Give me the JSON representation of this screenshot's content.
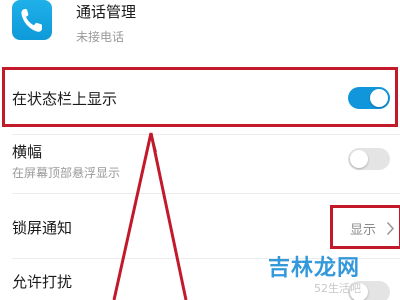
{
  "header": {
    "app_icon": "phone-icon",
    "app_name": "通话管理",
    "subtitle": "未接电话"
  },
  "settings": [
    {
      "title": "在状态栏上显示",
      "toggle_on": true
    },
    {
      "title": "横幅",
      "subtitle": "在屏幕顶部悬浮显示",
      "toggle_on": false
    },
    {
      "title": "锁屏通知",
      "value": "显示",
      "value_icon": "chevron-right-icon"
    },
    {
      "title": "允许打扰",
      "toggle_on": false
    }
  ],
  "watermark": {
    "logo": "吉林龙网",
    "url": "52生活吧"
  },
  "colors": {
    "accent": "#1296db",
    "annotation": "#c2192b",
    "toggle_off": "#e4e4e4",
    "app_icon": "#1fb0ea"
  }
}
